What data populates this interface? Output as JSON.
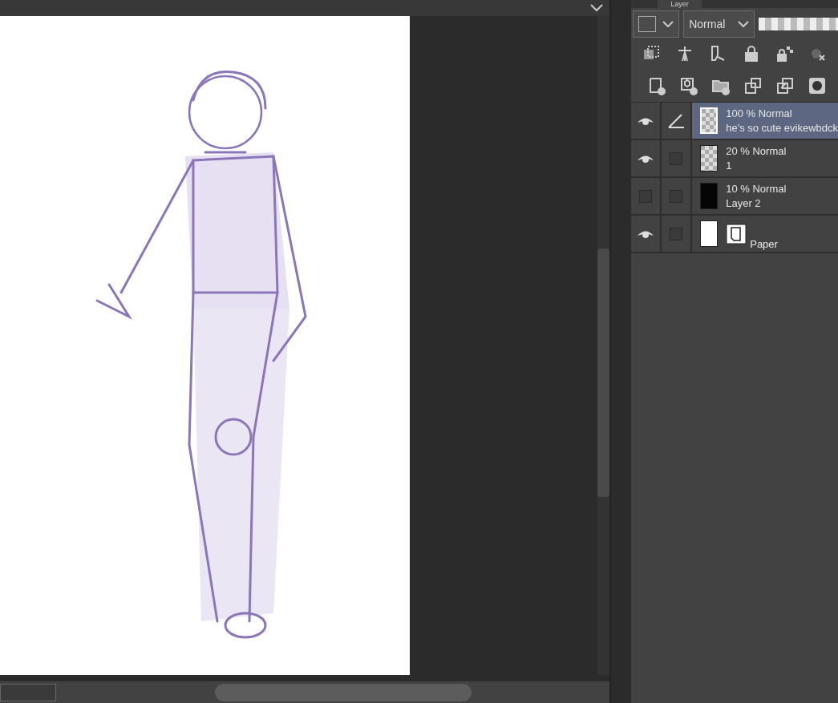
{
  "panel": {
    "tab": "Layer",
    "blend_mode": "Normal"
  },
  "layers": [
    {
      "opacity": "100 %",
      "blend": "Normal",
      "name": "he's so cute evikewbdck",
      "visible": true,
      "editing": true,
      "selected": true,
      "kind": "transparent"
    },
    {
      "opacity": "20 %",
      "blend": "Normal",
      "name": "1",
      "visible": true,
      "editing": false,
      "selected": false,
      "kind": "sketch"
    },
    {
      "opacity": "10 %",
      "blend": "Normal",
      "name": "Layer 2",
      "visible": false,
      "editing": false,
      "selected": false,
      "kind": "dark"
    },
    {
      "name": "Paper",
      "visible": true,
      "editing": false,
      "selected": false,
      "kind": "paper"
    }
  ]
}
